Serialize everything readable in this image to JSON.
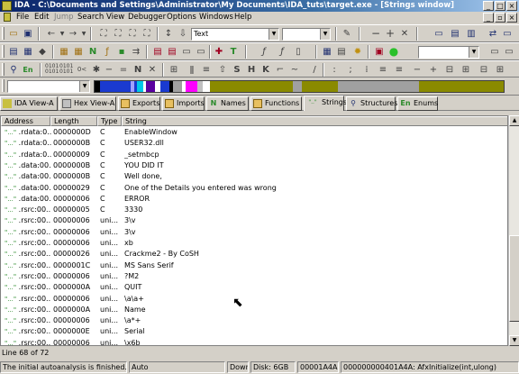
{
  "window": {
    "title": "IDA - C:\\Documents and Settings\\Administrator\\My Documents\\IDA_tuts\\target.exe - [Strings window]"
  },
  "menu": [
    "File",
    "Edit",
    "Jump",
    "Search",
    "View",
    "Debugger",
    "Options",
    "Windows",
    "Help"
  ],
  "toolbar": {
    "font_combo": "Text"
  },
  "tabs": [
    {
      "label": "IDA View-A"
    },
    {
      "label": "Hex View-A"
    },
    {
      "label": "Exports"
    },
    {
      "label": "Imports"
    },
    {
      "label": "Names"
    },
    {
      "label": "Functions"
    },
    {
      "label": "Strings"
    },
    {
      "label": "Structures"
    },
    {
      "label": "Enums"
    }
  ],
  "tab_icon_text": {
    "names": "N",
    "strings": "\"..\"",
    "enums": "En"
  },
  "table": {
    "headers": [
      "Address",
      "Length",
      "Type",
      "String"
    ],
    "rows": [
      [
        "\".rdata:0...",
        "0000000D",
        "C",
        "EnableWindow"
      ],
      [
        "\".rdata:0...",
        "0000000B",
        "C",
        "USER32.dll"
      ],
      [
        "\".rdata:0...",
        "00000009",
        "C",
        "_setmbcp"
      ],
      [
        "\".data:00...",
        "0000000B",
        "C",
        "YOU DID IT"
      ],
      [
        "\".data:00...",
        "0000000B",
        "C",
        "Well done,"
      ],
      [
        "\".data:00...",
        "00000029",
        "C",
        "One of the Details you entered was wrong"
      ],
      [
        "\".data:00...",
        "00000006",
        "C",
        "ERROR"
      ],
      [
        "\".rsrc:00...",
        "00000005",
        "C",
        "3330"
      ],
      [
        "\".rsrc:00...",
        "00000006",
        "uni...",
        "3\\v"
      ],
      [
        "\".rsrc:00...",
        "00000006",
        "uni...",
        "3\\v"
      ],
      [
        "\".rsrc:00...",
        "00000006",
        "uni...",
        "xb"
      ],
      [
        "\".rsrc:00...",
        "00000026",
        "uni...",
        "Crackme2 - By CoSH"
      ],
      [
        "\".rsrc:00...",
        "0000001C",
        "uni...",
        "MS Sans Serif"
      ],
      [
        "\".rsrc:00...",
        "00000006",
        "uni...",
        "?M2"
      ],
      [
        "\".rsrc:00...",
        "0000000A",
        "uni...",
        "QUIT"
      ],
      [
        "\".rsrc:00...",
        "00000006",
        "uni...",
        "\\a\\a+"
      ],
      [
        "\".rsrc:00...",
        "0000000A",
        "uni...",
        "Name"
      ],
      [
        "\".rsrc:00...",
        "00000006",
        "uni...",
        "\\a*+"
      ],
      [
        "\".rsrc:00...",
        "0000000E",
        "uni...",
        "Serial"
      ],
      [
        "\".rsrc:00...",
        "00000006",
        "uni...",
        "\\x6b"
      ]
    ]
  },
  "line_info": "Line 68 of 72",
  "status": {
    "message": "The initial autoanalysis is finished.",
    "mode": "Auto",
    "direction": "Down",
    "disk": "Disk: 6GB",
    "offset": "00001A4A",
    "location": "000000000401A4A: AfxInitialize(int,ulong)"
  },
  "colors": {
    "title_active": "#0a246a",
    "chrome": "#d4d0c8",
    "string_icon": "#2a8a2a"
  }
}
